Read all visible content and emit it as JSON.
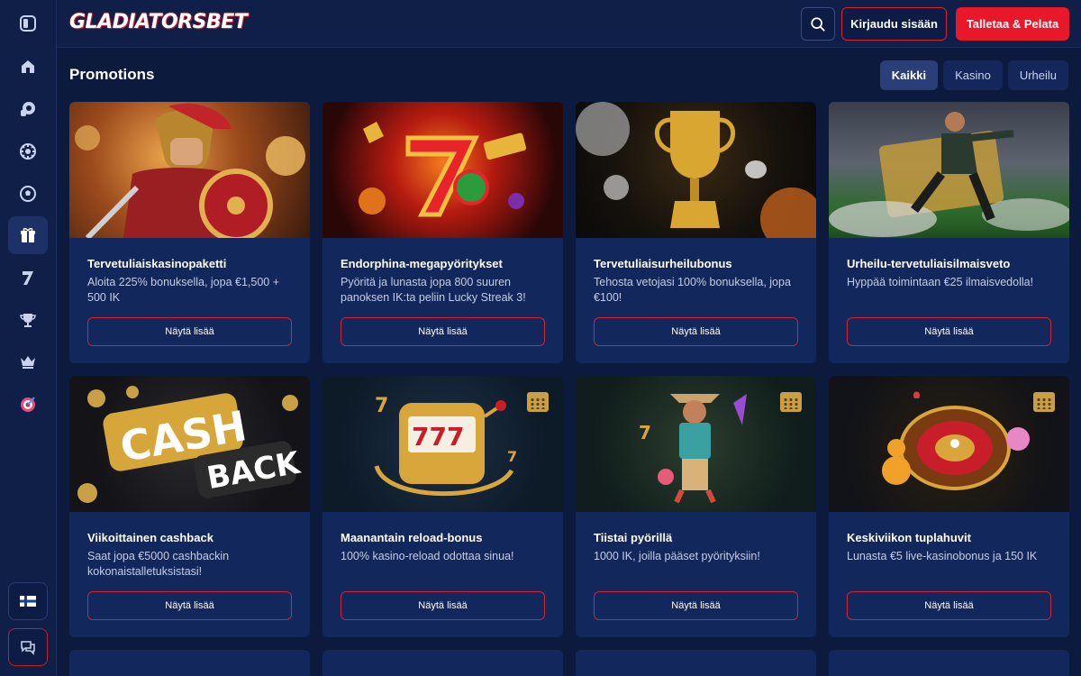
{
  "header": {
    "logo": "GLADIATORSBET",
    "login_label": "Kirjaudu sisään",
    "deposit_label": "Talletaa & Pelata"
  },
  "page": {
    "title": "Promotions"
  },
  "filters": [
    {
      "label": "Kaikki",
      "active": true
    },
    {
      "label": "Kasino",
      "active": false
    },
    {
      "label": "Urheilu",
      "active": false
    }
  ],
  "cards": [
    {
      "title": "Tervetuliaiskasinopaketti",
      "desc": "Aloita 225% bonuksella, jopa €1,500 + 500 IK",
      "button": "Näytä lisää",
      "image": "gladiator-warrior"
    },
    {
      "title": "Endorphina-megapyöritykset",
      "desc": "Pyöritä ja lunasta jopa 800 suuren panoksen IK:ta peliin Lucky Streak 3!",
      "button": "Näytä lisää",
      "image": "lucky-seven-slot"
    },
    {
      "title": "Tervetuliaisurheilubonus",
      "desc": "Tehosta vetojasi 100% bonuksella, jopa €100!",
      "button": "Näytä lisää",
      "image": "gold-trophy"
    },
    {
      "title": "Urheilu-tervetuliaisilmaisveto",
      "desc": "Hyppää toimintaan €25 ilmaisvedolla!",
      "button": "Näytä lisää",
      "image": "football-player"
    },
    {
      "title": "Viikoittainen cashback",
      "desc": "Saat jopa €5000 cashbackin kokonaistalletuksistasi!",
      "button": "Näytä lisää",
      "image": "cashback-sign"
    },
    {
      "title": "Maanantain reload-bonus",
      "desc": "100% kasino-reload odottaa sinua!",
      "button": "Näytä lisää",
      "image": "slot-machine-777"
    },
    {
      "title": "Tiistai pyörillä",
      "desc": "1000 IK, joilla pääset pyörityksiin!",
      "button": "Näytä lisää",
      "image": "cowboy-character"
    },
    {
      "title": "Keskiviikon tuplahuvit",
      "desc": "Lunasta €5 live-kasinobonus ja 150 IK",
      "button": "Näytä lisää",
      "image": "roulette-wheel"
    }
  ],
  "sidebar": {
    "items": [
      "collapse-icon",
      "home-icon",
      "casino-chip-icon",
      "poker-chip-icon",
      "football-icon",
      "gift-icon",
      "seven-icon",
      "trophy-icon",
      "crown-icon",
      "target-icon"
    ],
    "bottom": [
      "language-flag-icon",
      "chat-icon"
    ]
  },
  "colors": {
    "accent_red": "#e8172a",
    "background": "#0c1a3d",
    "card": "#12275c"
  }
}
